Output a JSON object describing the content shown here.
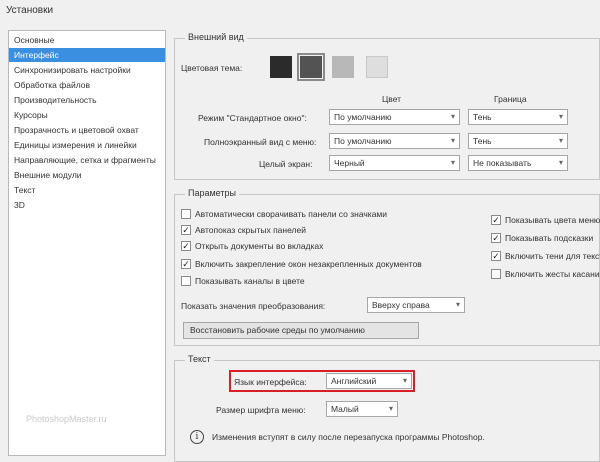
{
  "window": {
    "title": "Установки"
  },
  "sidebar": {
    "items": [
      {
        "label": "Основные"
      },
      {
        "label": "Интерфейс",
        "selected": true
      },
      {
        "label": "Синхронизировать настройки"
      },
      {
        "label": "Обработка файлов"
      },
      {
        "label": "Производительность"
      },
      {
        "label": "Курсоры"
      },
      {
        "label": "Прозрачность и цветовой охват"
      },
      {
        "label": "Единицы измерения и линейки"
      },
      {
        "label": "Направляющие, сетка и фрагменты"
      },
      {
        "label": "Внешние модули"
      },
      {
        "label": "Текст"
      },
      {
        "label": "3D"
      }
    ]
  },
  "watermark": "PhotoshopMaster.ru",
  "appearance": {
    "legend": "Внешний вид",
    "theme_label": "Цветовая тема:",
    "theme_colors": [
      "#2b2b2b",
      "#535353",
      "#b8b8b8",
      "#dedede"
    ],
    "col_color": "Цвет",
    "col_border": "Граница",
    "rows": [
      {
        "label": "Режим \"Стандартное окно\":",
        "color": "По умолчанию",
        "border": "Тень"
      },
      {
        "label": "Полноэкранный вид с меню:",
        "color": "По умолчанию",
        "border": "Тень"
      },
      {
        "label": "Целый экран:",
        "color": "Черный",
        "border": "Не показывать"
      }
    ]
  },
  "options": {
    "legend": "Параметры",
    "left_checks": [
      {
        "label": "Автоматически сворачивать панели со значками",
        "checked": false
      },
      {
        "label": "Автопоказ скрытых панелей",
        "checked": true
      },
      {
        "label": "Открыть документы во вкладках",
        "checked": true
      },
      {
        "label": "Включить закрепление окон незакрепленных документов",
        "checked": true
      },
      {
        "label": "Показывать каналы в цвете",
        "checked": false
      }
    ],
    "right_checks": [
      {
        "label": "Показывать цвета меню",
        "checked": true
      },
      {
        "label": "Показывать подсказки",
        "checked": true
      },
      {
        "label": "Включить тени для текста",
        "checked": true
      },
      {
        "label": "Включить жесты касания",
        "checked": false
      }
    ],
    "preview_label": "Показать значения преобразования:",
    "preview_value": "Вверху справа",
    "reset_button": "Восстановить рабочие среды по умолчанию"
  },
  "text": {
    "legend": "Текст",
    "ui_language_label": "Язык интерфейса:",
    "ui_language_value": "Английский",
    "font_size_label": "Размер шрифта меню:",
    "font_size_value": "Малый",
    "info": "Изменения вступят в силу после перезапуска программы Photoshop."
  }
}
